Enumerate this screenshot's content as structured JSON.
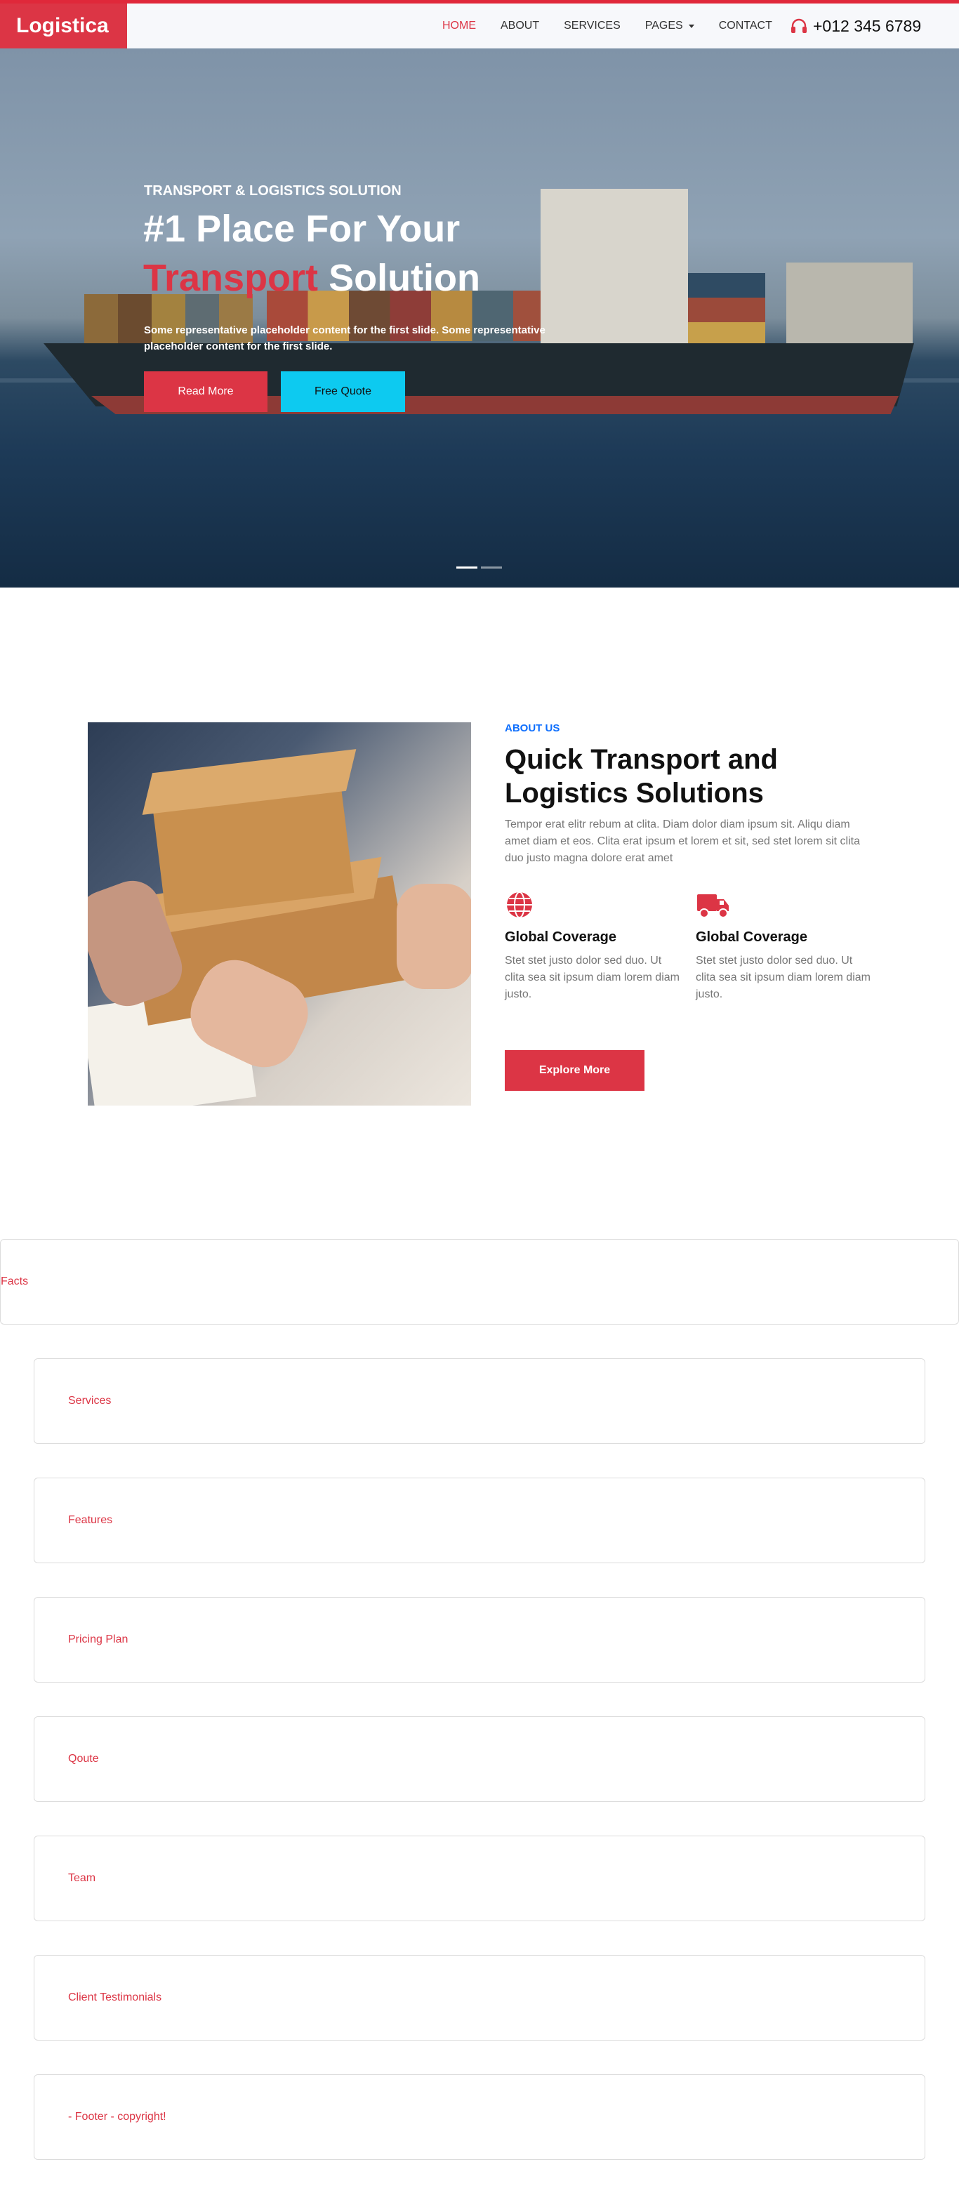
{
  "brand": {
    "name": "Logistica"
  },
  "nav": {
    "items": [
      {
        "label": "HOME",
        "active": true
      },
      {
        "label": "ABOUT",
        "active": false
      },
      {
        "label": "SERVICES",
        "active": false
      },
      {
        "label": "PAGES",
        "active": false,
        "dropdown": true
      },
      {
        "label": "CONTACT",
        "active": false
      }
    ],
    "phone": "+012 345 6789",
    "phone_icon": "headphones-icon"
  },
  "hero": {
    "subtitle": "TRANSPORT & LOGISTICS SOLUTION",
    "title_line1": "#1 Place For Your",
    "title_highlight": "Transport",
    "title_rest": "Solution",
    "description": "Some representative placeholder content for the first slide. Some representative placeholder content for the first slide.",
    "btn_primary": "Read More",
    "btn_secondary": "Free Quote",
    "slides": 2,
    "active_slide": 1
  },
  "about": {
    "label": "ABOUT US",
    "title": "Quick Transport and Logistics Solutions",
    "text": "Tempor erat elitr rebum at clita. Diam dolor diam ipsum sit. Aliqu diam amet diam et eos. Clita erat ipsum et lorem et sit, sed stet lorem sit clita duo justo magna dolore erat amet",
    "features": [
      {
        "icon": "globe-icon",
        "title": "Global Coverage",
        "text": "Stet stet justo dolor sed duo. Ut clita sea sit ipsum diam lorem diam justo."
      },
      {
        "icon": "truck-icon",
        "title": "Global Coverage",
        "text": "Stet stet justo dolor sed duo. Ut clita sea sit ipsum diam lorem diam justo."
      }
    ],
    "button": "Explore More"
  },
  "sections": {
    "facts": "Facts",
    "services": "Services",
    "features": "Features",
    "pricing": "Pricing Plan",
    "quote": "Qoute",
    "team": "Team",
    "testimonials": "Client Testimonials",
    "footer": "- Footer - copyright!"
  },
  "colors": {
    "accent": "#dc3545",
    "cyan": "#0dcaf0",
    "link_blue": "#0d6efd"
  }
}
